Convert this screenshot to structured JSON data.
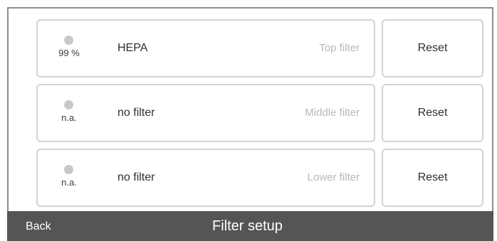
{
  "filters": [
    {
      "status_value": "99 %",
      "name": "HEPA",
      "position": "Top filter",
      "reset_label": "Reset"
    },
    {
      "status_value": "n.a.",
      "name": "no filter",
      "position": "Middle filter",
      "reset_label": "Reset"
    },
    {
      "status_value": "n.a.",
      "name": "no filter",
      "position": "Lower filter",
      "reset_label": "Reset"
    }
  ],
  "footer": {
    "back_label": "Back",
    "title": "Filter setup"
  },
  "colors": {
    "status_dot": "#c8c8c8",
    "footer_bg": "#555555",
    "card_border": "#d3d3d3"
  }
}
